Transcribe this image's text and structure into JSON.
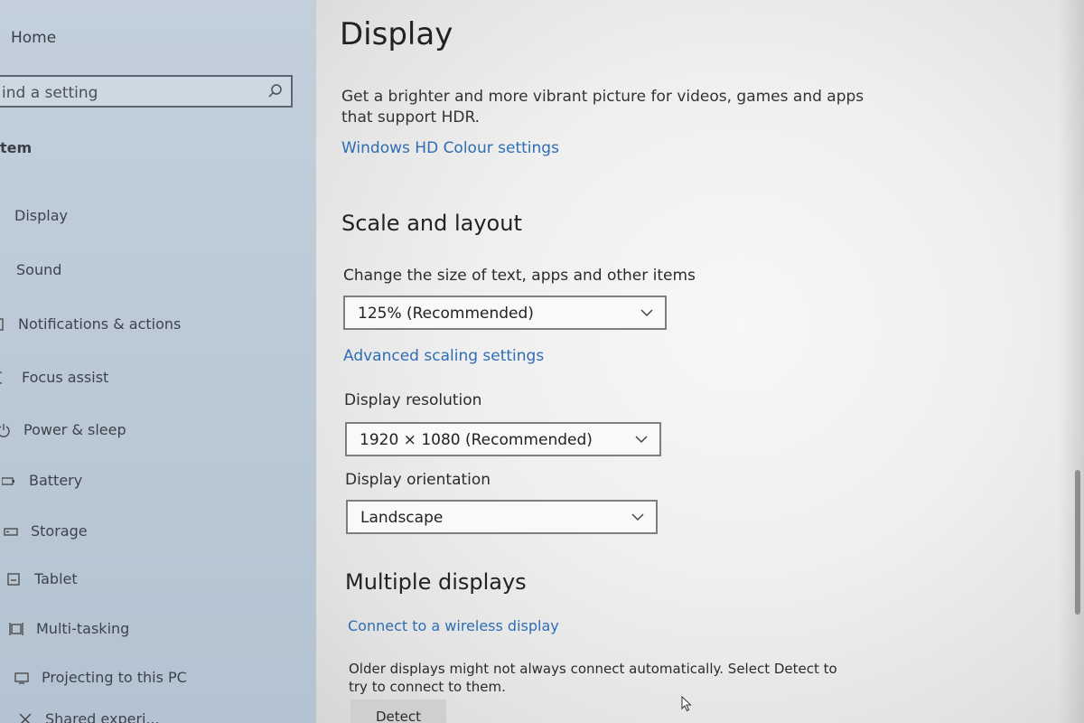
{
  "sidebar": {
    "home_label": "Home",
    "search_placeholder": "ind a setting",
    "section_label": "tem",
    "items": [
      {
        "label": "Display",
        "icon": "monitor-icon"
      },
      {
        "label": "Sound",
        "icon": "speaker-icon"
      },
      {
        "label": "Notifications & actions",
        "icon": "notifications-icon"
      },
      {
        "label": "Focus assist",
        "icon": "moon-icon"
      },
      {
        "label": "Power & sleep",
        "icon": "power-icon"
      },
      {
        "label": "Battery",
        "icon": "battery-icon"
      },
      {
        "label": "Storage",
        "icon": "storage-icon"
      },
      {
        "label": "Tablet",
        "icon": "tablet-icon"
      },
      {
        "label": "Multi-tasking",
        "icon": "multitasking-icon"
      },
      {
        "label": "Projecting to this PC",
        "icon": "projecting-icon"
      },
      {
        "label": "Shared experi...",
        "icon": "shared-icon"
      }
    ]
  },
  "main": {
    "title": "Display",
    "hdr_text": "Get a brighter and more vibrant picture for videos, games and apps that support HDR.",
    "hdr_link": "Windows HD Colour settings",
    "scale_heading": "Scale and layout",
    "scale_label": "Change the size of text, apps and other items",
    "scale_value": "125% (Recommended)",
    "advanced_link": "Advanced scaling settings",
    "resolution_label": "Display resolution",
    "resolution_value": "1920 × 1080 (Recommended)",
    "orientation_label": "Display orientation",
    "orientation_value": "Landscape",
    "multi_heading": "Multiple displays",
    "wireless_link": "Connect to a wireless display",
    "detect_text": "Older displays might not always connect automatically. Select Detect to try to connect to them.",
    "detect_button": "Detect"
  },
  "colors": {
    "link": "#2e6db4",
    "sidebar_bg": "#bccad7",
    "main_bg": "#efefef"
  }
}
